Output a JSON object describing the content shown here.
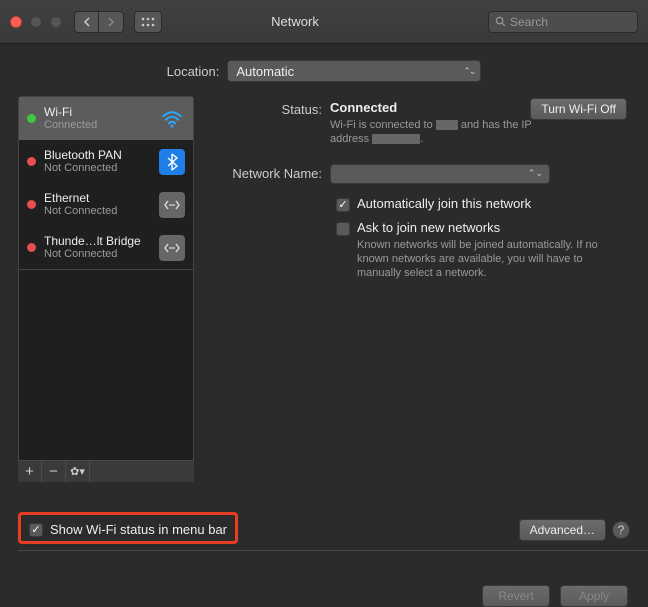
{
  "titlebar": {
    "title": "Network",
    "search_placeholder": "Search"
  },
  "location": {
    "label": "Location:",
    "value": "Automatic"
  },
  "sidebar": {
    "items": [
      {
        "name": "Wi-Fi",
        "status": "Connected",
        "dot": "green",
        "icon": "wifi"
      },
      {
        "name": "Bluetooth PAN",
        "status": "Not Connected",
        "dot": "red",
        "icon": "bt"
      },
      {
        "name": "Ethernet",
        "status": "Not Connected",
        "dot": "red",
        "icon": "eth"
      },
      {
        "name": "Thunde…lt Bridge",
        "status": "Not Connected",
        "dot": "red",
        "icon": "eth"
      }
    ]
  },
  "details": {
    "status_label": "Status:",
    "status_value": "Connected",
    "status_desc_pre": "Wi-Fi is connected to ",
    "status_desc_mid": " and has the IP address ",
    "status_desc_end": ".",
    "turn_off": "Turn Wi-Fi Off",
    "name_label": "Network Name:",
    "auto_join": "Automatically join this network",
    "ask_join": "Ask to join new networks",
    "ask_desc": "Known networks will be joined automatically. If no known networks are available, you will have to manually select a network."
  },
  "bottom": {
    "show_status": "Show Wi-Fi status in menu bar",
    "advanced": "Advanced…"
  },
  "footer": {
    "revert": "Revert",
    "apply": "Apply"
  }
}
